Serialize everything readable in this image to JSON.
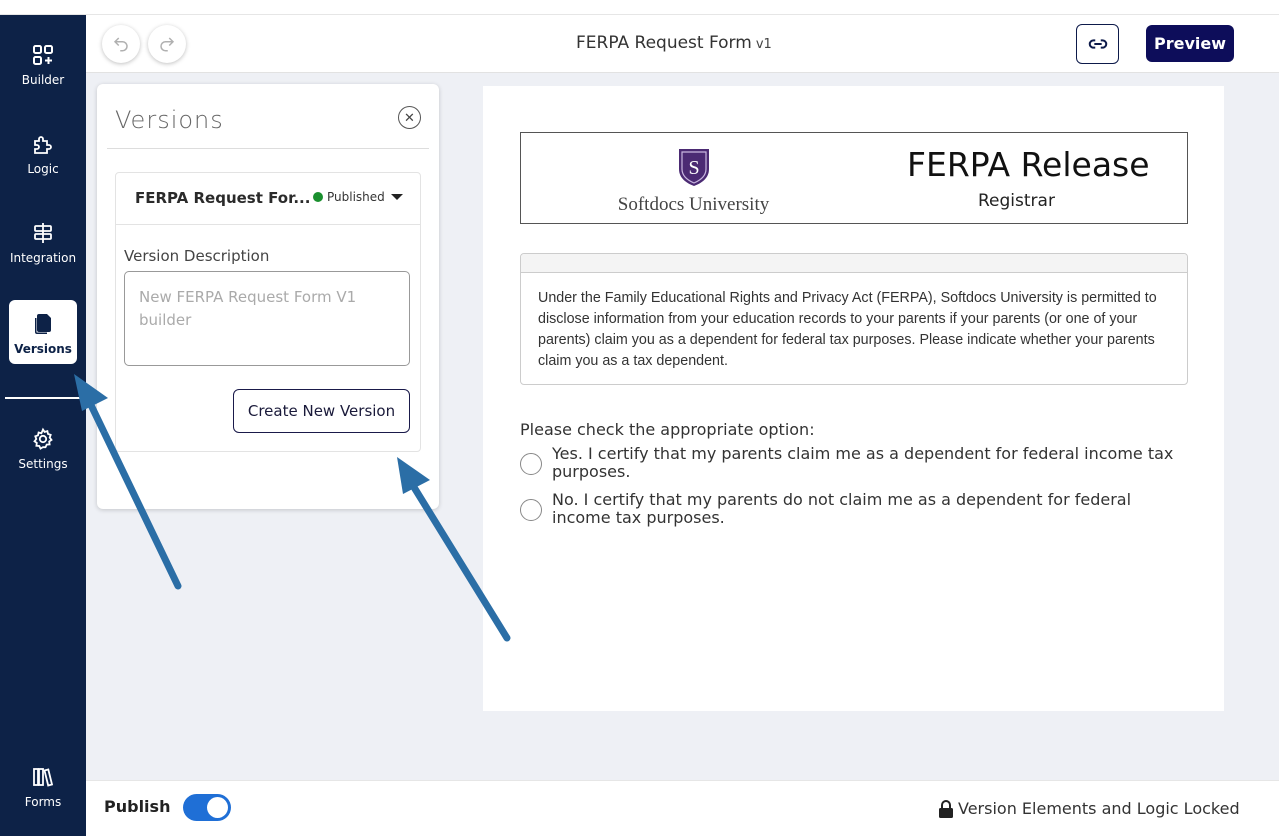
{
  "sidebar": {
    "items": [
      {
        "label": "Builder",
        "icon": "builder-icon"
      },
      {
        "label": "Logic",
        "icon": "puzzle-icon"
      },
      {
        "label": "Integration",
        "icon": "signpost-icon"
      },
      {
        "label": "Versions",
        "icon": "documents-icon",
        "active": true
      },
      {
        "label": "Settings",
        "icon": "gear-icon"
      },
      {
        "label": "Forms",
        "icon": "books-icon"
      }
    ]
  },
  "header": {
    "title": "FERPA Request Form",
    "version": "v1",
    "preview_label": "Preview"
  },
  "versions_panel": {
    "title": "Versions",
    "card": {
      "name": "FERPA Request For...",
      "status": "Published",
      "description_label": "Version Description",
      "description_placeholder": "New FERPA Request Form V1 builder",
      "create_button": "Create New Version"
    }
  },
  "form": {
    "logo_text": "Softdocs University",
    "logo_letter": "S",
    "banner_title": "FERPA Release",
    "banner_subtitle": "Registrar",
    "notice": "Under the Family Educational Rights and Privacy Act (FERPA), Softdocs University is permitted to disclose information from your education records to your parents if your parents (or one of your parents) claim you as a dependent for federal tax purposes. Please indicate whether your parents claim you as a tax dependent.",
    "question": "Please check the appropriate option:",
    "options": [
      "Yes. I certify that my parents claim me as a dependent for federal income tax purposes.",
      "No. I certify that my parents do not claim me as a dependent for federal income tax purposes."
    ]
  },
  "footer": {
    "publish_label": "Publish",
    "publish_on": true,
    "locked_text": "Version Elements and Logic Locked"
  },
  "colors": {
    "sidebar_bg": "#0d2247",
    "preview_bg": "#0d0d5a",
    "toggle_on": "#1f6fd6",
    "published_dot": "#1a8f2e",
    "arrow": "#2b6ea6",
    "logo_purple": "#4b2a73"
  }
}
